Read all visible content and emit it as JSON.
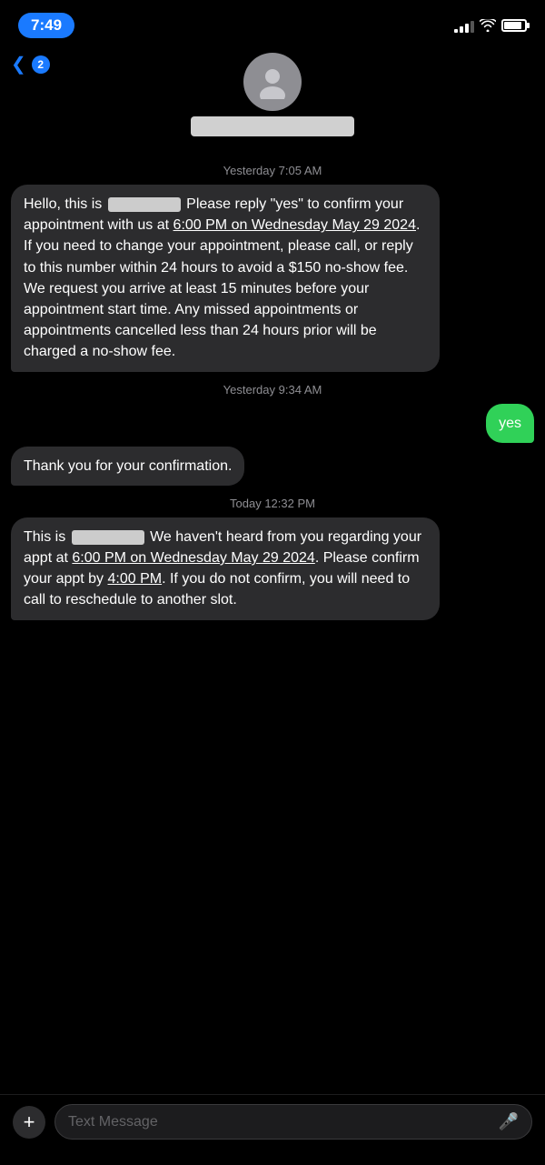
{
  "statusBar": {
    "time": "7:49",
    "backCount": "2"
  },
  "header": {
    "contactNameBlurred": true
  },
  "timestampLabels": {
    "yesterday_morning": "Yesterday 7:05 AM",
    "yesterday_afternoon": "Yesterday 9:34 AM",
    "today": "Today 12:32 PM"
  },
  "messages": [
    {
      "id": "msg1",
      "type": "incoming",
      "text": "Hello, this is [REDACTED] Please reply \"yes\" to confirm your appointment with us at 6:00 PM on Wednesday May 29 2024. If you need to change your appointment, please call, or reply to this number within 24 hours to avoid a $150 no-show fee. We request you arrive at least 15 minutes before your appointment start time. Any missed appointments or appointments cancelled less than 24 hours prior will be charged a no-show fee.",
      "time": "Yesterday 7:05 AM"
    },
    {
      "id": "msg2",
      "type": "outgoing",
      "text": "yes",
      "time": "Yesterday 9:34 AM"
    },
    {
      "id": "msg3",
      "type": "incoming",
      "text": "Thank you for your confirmation.",
      "time": "Yesterday 9:34 AM"
    },
    {
      "id": "msg4",
      "type": "incoming",
      "text": "This is [REDACTED] We haven't heard from you regarding your appt at 6:00 PM on Wednesday May 29 2024. Please confirm your appt by 4:00 PM. If you do not confirm, you will need to call to reschedule to another slot.",
      "time": "Today 12:32 PM"
    }
  ],
  "inputBar": {
    "placeholder": "Text Message",
    "addButton": "+",
    "micIcon": "🎤"
  }
}
